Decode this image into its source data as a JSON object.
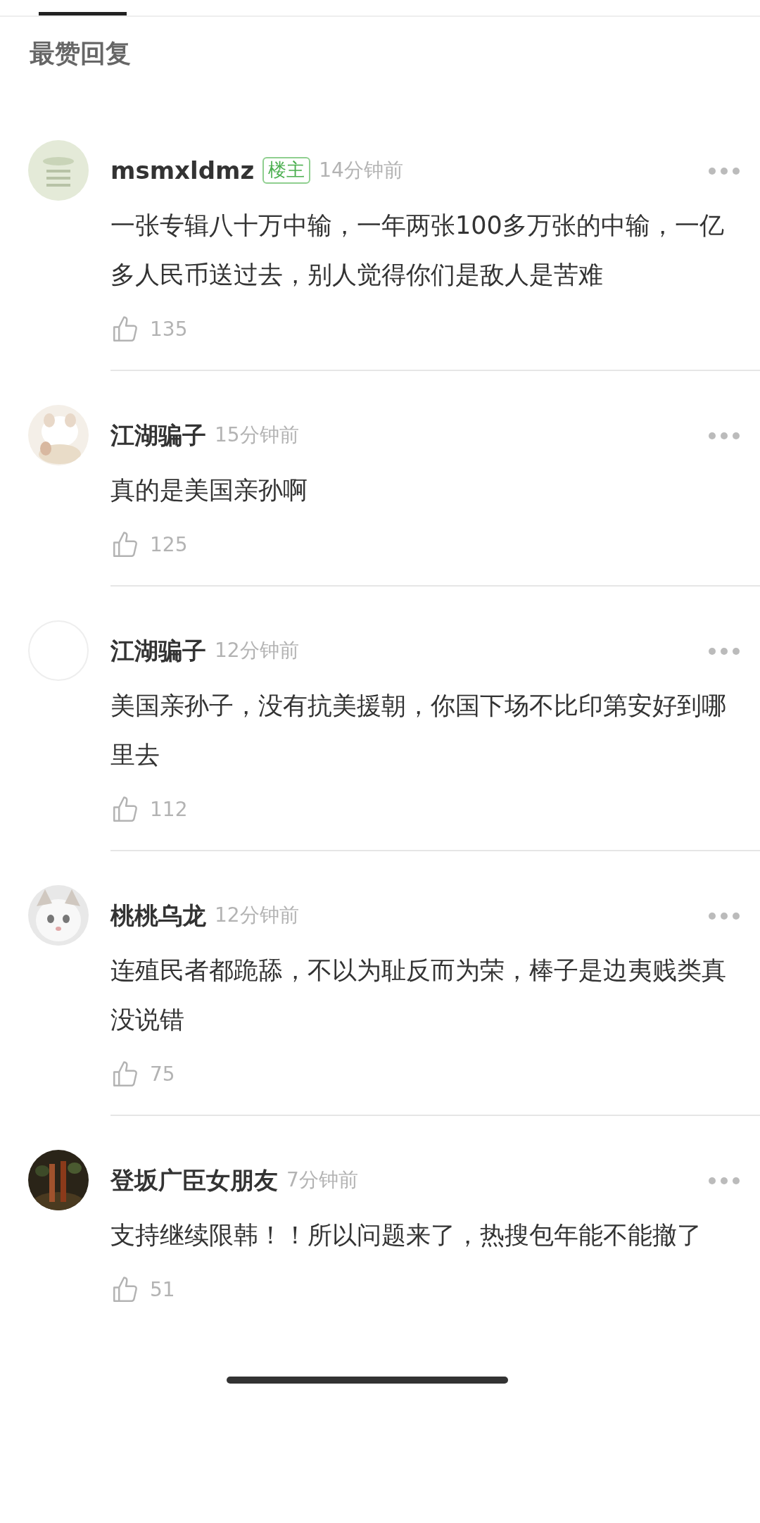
{
  "section_title": "最赞回复",
  "comments": [
    {
      "name": "msmxldmz",
      "badge": "楼主",
      "time": "14分钟前",
      "text": "一张专辑八十万中输，一年两张100多万张的中输，一亿多人民币送过去，别人觉得你们是敌人是苦难",
      "likes": "135"
    },
    {
      "name": "江湖骗子",
      "time": "15分钟前",
      "text": "真的是美国亲孙啊",
      "likes": "125"
    },
    {
      "avatar": {
        "kind": "blank"
      },
      "name": "江湖骗子",
      "time": "12分钟前",
      "text": "美国亲孙子，没有抗美援朝，你国下场不比印第安好到哪里去",
      "likes": "112"
    },
    {
      "name": "桃桃乌龙",
      "time": "12分钟前",
      "text": "连殖民者都跪舔，不以为耻反而为荣，棒子是边夷贱类真没说错",
      "likes": "75"
    },
    {
      "name": "登坂广臣女朋友",
      "time": "7分钟前",
      "text": "支持继续限韩！！所以问题来了，热搜包年能不能撤了",
      "likes": "51"
    }
  ]
}
